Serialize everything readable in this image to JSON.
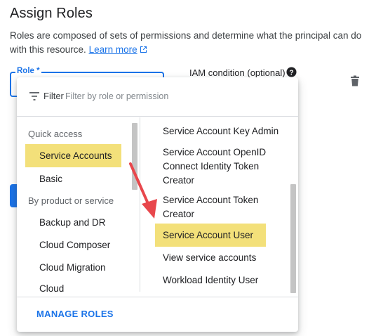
{
  "header": {
    "title": "Assign Roles",
    "description": "Roles are composed of sets of permissions and determine what the principal can do with this resource.",
    "learn_more": "Learn more"
  },
  "role_field": {
    "label": "Role *"
  },
  "iam_condition": {
    "label": "IAM condition (optional)"
  },
  "dropdown": {
    "filter_label": "Filter",
    "filter_placeholder": "Filter by role or permission",
    "left": {
      "quick_access": "Quick access",
      "service_accounts": "Service Accounts",
      "basic": "Basic",
      "by_product": "By product or service",
      "backup_dr": "Backup and DR",
      "cloud_composer": "Cloud Composer",
      "cloud_migration": "Cloud Migration",
      "cloud": "Cloud"
    },
    "right": {
      "key_admin": "Service Account Key Admin",
      "openid_l1": "Service Account OpenID",
      "openid_l2": "Connect Identity Token",
      "openid_l3": "Creator",
      "token_l1": "Service Account Token",
      "token_l2": "Creator",
      "user": "Service Account User",
      "view": "View service accounts",
      "workload": "Workload Identity User"
    },
    "manage_roles": "MANAGE ROLES"
  },
  "colors": {
    "accent": "#1a73e8",
    "highlight": "#f3e07a",
    "annotation_arrow": "#e8474c"
  },
  "icons": [
    "external-link-icon",
    "help-icon",
    "trash-icon",
    "filter-icon"
  ]
}
